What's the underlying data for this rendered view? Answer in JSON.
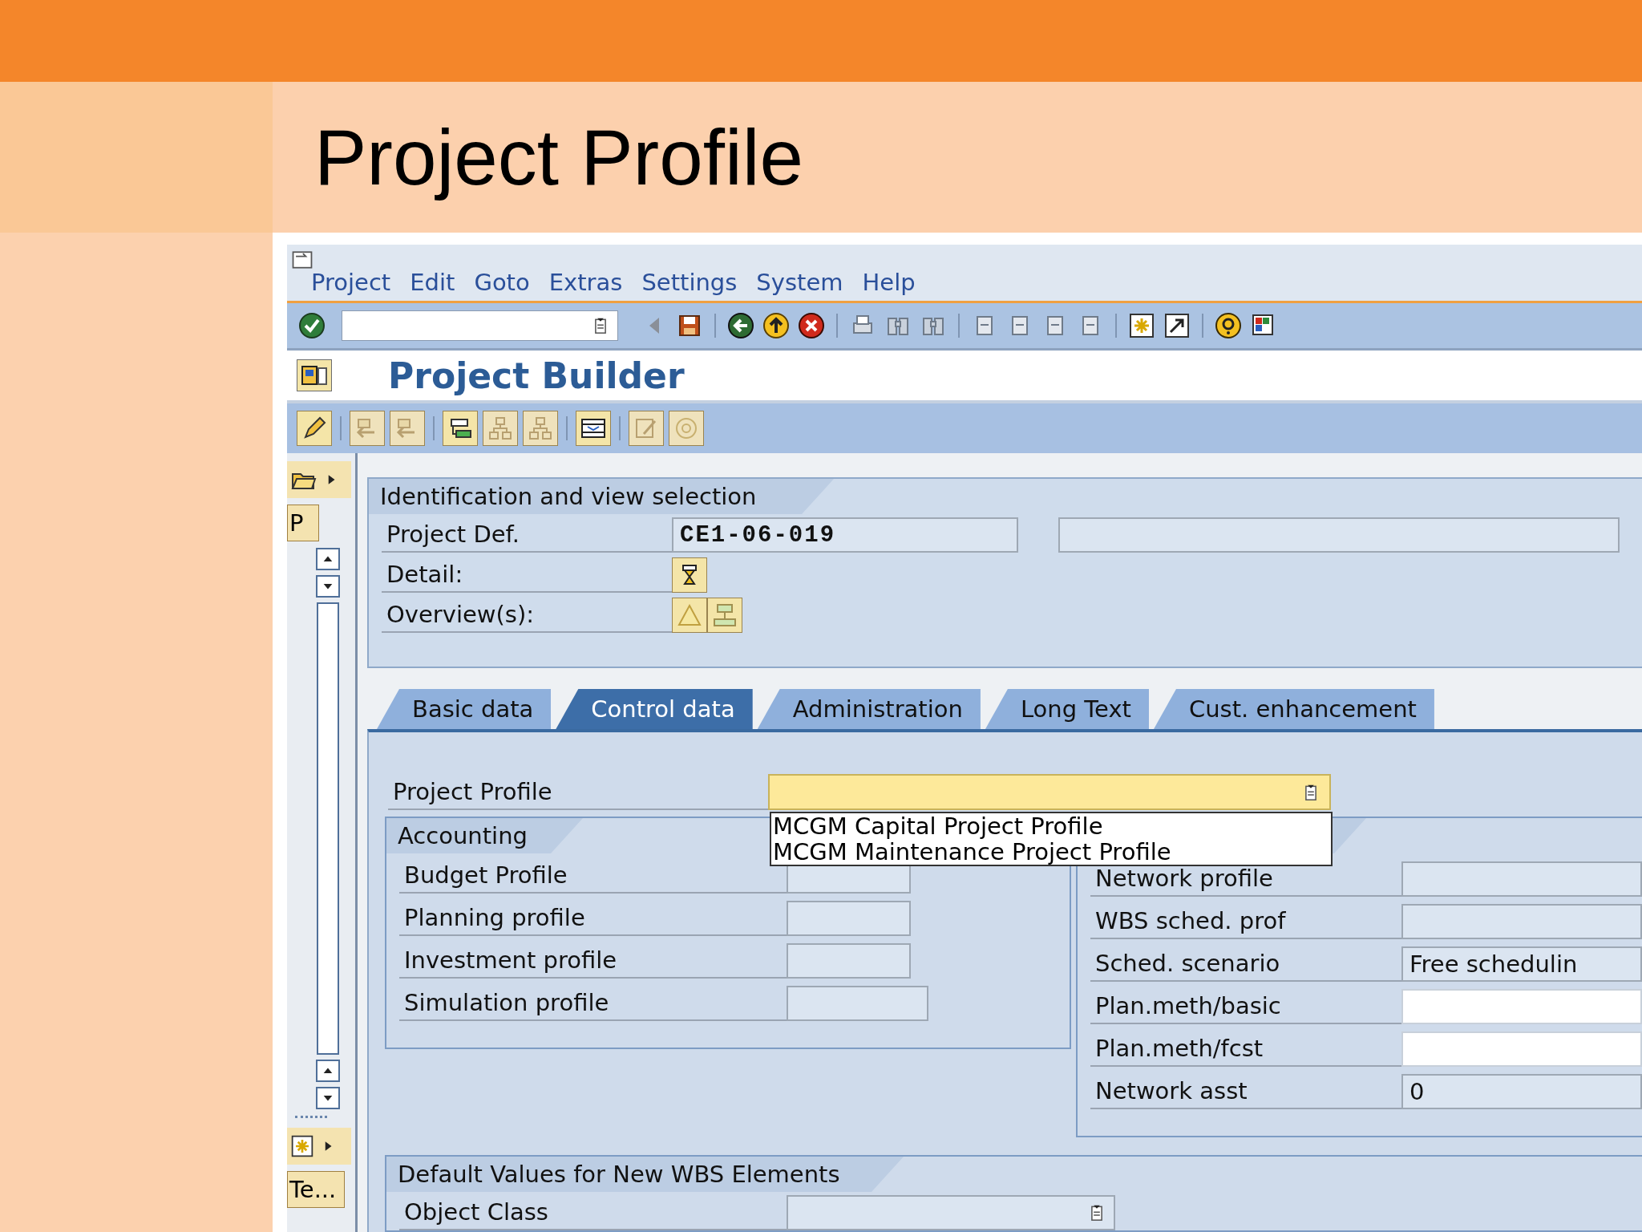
{
  "slide_title": "Project Profile",
  "menu": [
    "Project",
    "Edit",
    "Goto",
    "Extras",
    "Settings",
    "System",
    "Help"
  ],
  "screen_title": "Project Builder",
  "nav": {
    "top_label": "P",
    "bottom_label": "Te..."
  },
  "identification": {
    "title": "Identification and view selection",
    "project_def_label": "Project Def.",
    "project_def_value": "CE1-06-019",
    "detail_label": "Detail:",
    "overview_label": "Overview(s):"
  },
  "tabs": [
    {
      "label": "Basic data",
      "selected": false
    },
    {
      "label": "Control data",
      "selected": true
    },
    {
      "label": "Administration",
      "selected": false
    },
    {
      "label": "Long Text",
      "selected": false
    },
    {
      "label": "Cust. enhancement",
      "selected": false
    }
  ],
  "project_profile": {
    "label": "Project Profile",
    "options": [
      "MCGM Capital Project Profile",
      "MCGM Maintenance Project Profile"
    ]
  },
  "accounting": {
    "title": "Accounting",
    "rows": [
      {
        "label": "Budget Profile"
      },
      {
        "label": "Planning profile"
      },
      {
        "label": "Investment profile"
      },
      {
        "label": "Simulation profile"
      }
    ]
  },
  "scheduling": {
    "rows": [
      {
        "label": "Network profile",
        "editable": false
      },
      {
        "label": "WBS sched. prof",
        "editable": false
      },
      {
        "label": "Sched. scenario",
        "value": "Free schedulin",
        "editable": false
      },
      {
        "label": "Plan.meth/basic",
        "editable": true
      },
      {
        "label": "Plan.meth/fcst",
        "editable": true
      },
      {
        "label": "Network asst",
        "value": "0",
        "editable": false
      }
    ]
  },
  "defaults": {
    "title": "Default Values for New WBS Elements",
    "rows": [
      {
        "label": "Object Class"
      }
    ]
  }
}
